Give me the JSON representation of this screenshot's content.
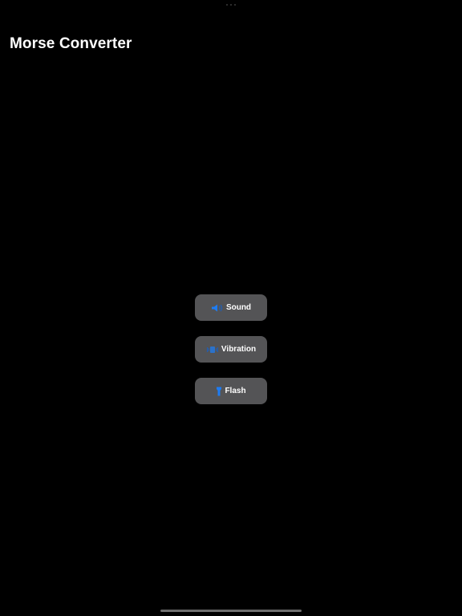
{
  "app": {
    "title": "Morse Converter"
  },
  "buttons": [
    {
      "id": "sound",
      "label": "Sound",
      "icon": "speaker-icon"
    },
    {
      "id": "vibration",
      "label": "Vibration",
      "icon": "vibration-icon"
    },
    {
      "id": "flash",
      "label": "Flash",
      "icon": "flashlight-icon"
    }
  ],
  "colors": {
    "background": "#000000",
    "button": "#545456",
    "icon_accent": "#1e7cf2",
    "text": "#ffffff"
  }
}
